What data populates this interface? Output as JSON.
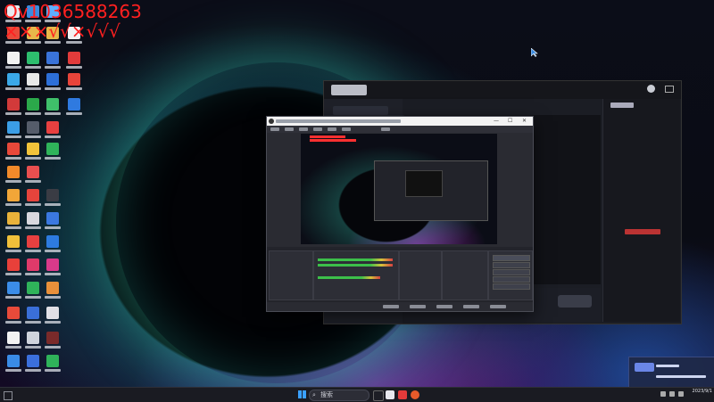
{
  "overlay": {
    "line1": "Qv1036588263",
    "line2": "×××√√×√√√"
  },
  "taskbar": {
    "search_label": "搜索"
  },
  "clock": {
    "date": "2023/9/1"
  }
}
